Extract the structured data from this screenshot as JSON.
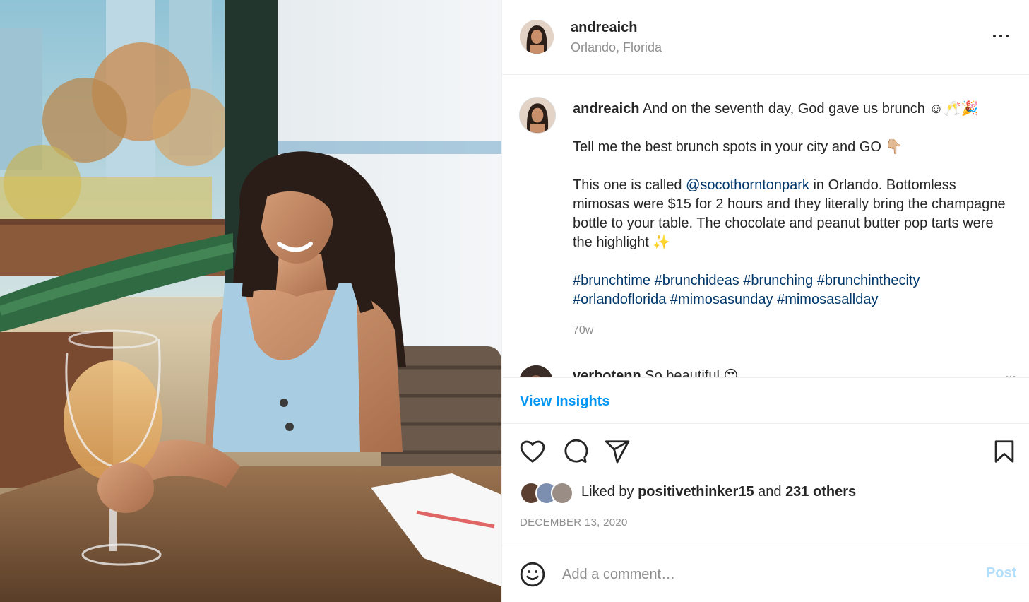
{
  "post": {
    "username": "andreaich",
    "location": "Orlando, Florida"
  },
  "caption": {
    "username": "andreaich",
    "line1": "And on the seventh day, God gave us brunch ☺🥂🎉",
    "line2": "Tell me the best brunch spots in your city and GO 👇🏼",
    "line3_prefix": "This one is called ",
    "mention": "@socothorntonpark",
    "line3_suffix": " in Orlando. Bottomless mimosas were $15 for 2 hours and they literally bring the champagne bottle to your table. The chocolate and peanut butter pop tarts were the highlight ✨",
    "hashtags": [
      "#brunchtime",
      "#brunchideas",
      "#brunching",
      "#brunchinthecity",
      "#orlandoflorida",
      "#mimosasunday",
      "#mimosasallday"
    ],
    "age": "70w"
  },
  "comment": {
    "username": "verbotenn",
    "text": "So beautiful 😍"
  },
  "insights_label": "View Insights",
  "actions": {
    "like_icon": "heart-icon",
    "comment_icon": "comment-bubble-icon",
    "share_icon": "paper-plane-icon",
    "save_icon": "bookmark-icon"
  },
  "likes": {
    "prefix": "Liked by ",
    "user": "positivethinker15",
    "middle": " and ",
    "others": "231 others"
  },
  "date": "DECEMBER 13, 2020",
  "add_comment": {
    "placeholder": "Add a comment…",
    "post_label": "Post"
  },
  "colors": {
    "link": "#00376b",
    "accent": "#0095f6",
    "post_disabled": "#b2dffc",
    "muted": "#8e8e8e"
  }
}
